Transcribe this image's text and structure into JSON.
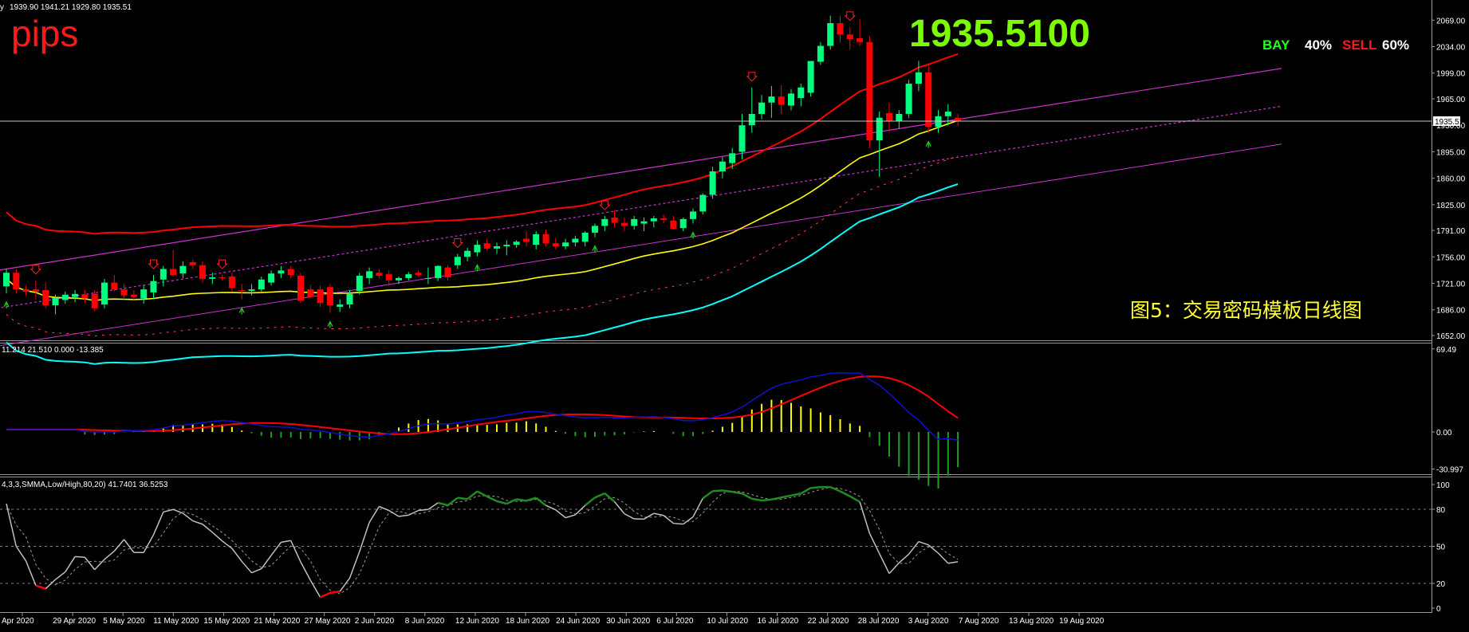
{
  "ohlc_header": "1939.90 1941.21 1929.80 1935.51",
  "watermark": "pips",
  "current_price_big": "1935.5100",
  "sentiment": {
    "buy_label": "BAY",
    "buy_pct": "40%",
    "sell_label": "SELL",
    "sell_pct": "60%",
    "buy_color": "#22ff22",
    "sell_color": "#ff1a1a"
  },
  "caption": "图5：交易密码模板日线图",
  "price_tag": "1935.51",
  "macd_label": "11.214 21.510 0.000 -13.385",
  "stoch_label": "4,3,3,SMMA,Low/High,80,20) 41.7401 36.5253",
  "colors": {
    "bull": "#00ff7f",
    "bear": "#ff0000",
    "ma_red": "#ff0000",
    "ma_yellow": "#ffff00",
    "ma_cyan": "#00ffff",
    "channel": "#cc33cc",
    "macd_signal": "#ff0000",
    "macd_main": "#0000cc",
    "stoch_main": "#c0c0c0",
    "stoch_up": "#228b22",
    "stoch_down": "#ff0000"
  },
  "chart_data": [
    {
      "type": "candlestick",
      "name": "price",
      "y_ticks": [
        "2069.00",
        "2034.00",
        "1999.00",
        "1965.00",
        "1930.00",
        "1895.00",
        "1860.00",
        "1825.00",
        "1791.00",
        "1756.00",
        "1721.00",
        "1686.00",
        "1652.00"
      ],
      "ylim": [
        1652,
        2083
      ],
      "x_labels": [
        "Apr 2020",
        "29 Apr 2020",
        "5 May 2020",
        "11 May 2020",
        "15 May 2020",
        "21 May 2020",
        "27 May 2020",
        "2 Jun 2020",
        "8 Jun 2020",
        "12 Jun 2020",
        "18 Jun 2020",
        "24 Jun 2020",
        "30 Jun 2020",
        "6 Jul 2020",
        "10 Jul 2020",
        "16 Jul 2020",
        "22 Jul 2020",
        "28 Jul 2020",
        "3 Aug 2020",
        "7 Aug 2020",
        "13 Aug 2020",
        "19 Aug 2020"
      ],
      "candles": [
        {
          "o": 1717,
          "h": 1740,
          "l": 1708,
          "c": 1735
        },
        {
          "o": 1735,
          "h": 1740,
          "l": 1708,
          "c": 1713
        },
        {
          "o": 1713,
          "h": 1718,
          "l": 1705,
          "c": 1710
        },
        {
          "o": 1713,
          "h": 1725,
          "l": 1700,
          "c": 1710
        },
        {
          "o": 1712,
          "h": 1722,
          "l": 1688,
          "c": 1692
        },
        {
          "o": 1692,
          "h": 1706,
          "l": 1680,
          "c": 1702
        },
        {
          "o": 1699,
          "h": 1710,
          "l": 1694,
          "c": 1706
        },
        {
          "o": 1703,
          "h": 1712,
          "l": 1696,
          "c": 1707
        },
        {
          "o": 1706,
          "h": 1712,
          "l": 1695,
          "c": 1701
        },
        {
          "o": 1707,
          "h": 1712,
          "l": 1684,
          "c": 1688
        },
        {
          "o": 1693,
          "h": 1727,
          "l": 1688,
          "c": 1722
        },
        {
          "o": 1722,
          "h": 1732,
          "l": 1710,
          "c": 1713
        },
        {
          "o": 1713,
          "h": 1720,
          "l": 1700,
          "c": 1705
        },
        {
          "o": 1706,
          "h": 1712,
          "l": 1698,
          "c": 1703
        },
        {
          "o": 1701,
          "h": 1718,
          "l": 1694,
          "c": 1713
        },
        {
          "o": 1709,
          "h": 1732,
          "l": 1700,
          "c": 1724
        },
        {
          "o": 1726,
          "h": 1744,
          "l": 1717,
          "c": 1740
        },
        {
          "o": 1740,
          "h": 1765,
          "l": 1730,
          "c": 1732
        },
        {
          "o": 1734,
          "h": 1750,
          "l": 1728,
          "c": 1744
        },
        {
          "o": 1749,
          "h": 1752,
          "l": 1740,
          "c": 1745
        },
        {
          "o": 1745,
          "h": 1750,
          "l": 1722,
          "c": 1727
        },
        {
          "o": 1727,
          "h": 1735,
          "l": 1720,
          "c": 1729
        },
        {
          "o": 1729,
          "h": 1732,
          "l": 1725,
          "c": 1728
        },
        {
          "o": 1730,
          "h": 1735,
          "l": 1710,
          "c": 1715
        },
        {
          "o": 1712,
          "h": 1720,
          "l": 1700,
          "c": 1711
        },
        {
          "o": 1711,
          "h": 1720,
          "l": 1705,
          "c": 1713
        },
        {
          "o": 1713,
          "h": 1730,
          "l": 1710,
          "c": 1726
        },
        {
          "o": 1722,
          "h": 1738,
          "l": 1718,
          "c": 1734
        },
        {
          "o": 1734,
          "h": 1744,
          "l": 1728,
          "c": 1738
        },
        {
          "o": 1740,
          "h": 1744,
          "l": 1728,
          "c": 1732
        },
        {
          "o": 1731,
          "h": 1735,
          "l": 1695,
          "c": 1698
        },
        {
          "o": 1713,
          "h": 1718,
          "l": 1702,
          "c": 1703
        },
        {
          "o": 1713,
          "h": 1718,
          "l": 1690,
          "c": 1695
        },
        {
          "o": 1716,
          "h": 1720,
          "l": 1682,
          "c": 1692
        },
        {
          "o": 1690,
          "h": 1700,
          "l": 1683,
          "c": 1693
        },
        {
          "o": 1693,
          "h": 1712,
          "l": 1688,
          "c": 1707
        },
        {
          "o": 1711,
          "h": 1735,
          "l": 1706,
          "c": 1731
        },
        {
          "o": 1728,
          "h": 1742,
          "l": 1720,
          "c": 1737
        },
        {
          "o": 1735,
          "h": 1740,
          "l": 1728,
          "c": 1731
        },
        {
          "o": 1733,
          "h": 1738,
          "l": 1718,
          "c": 1725
        },
        {
          "o": 1725,
          "h": 1730,
          "l": 1720,
          "c": 1728
        },
        {
          "o": 1728,
          "h": 1736,
          "l": 1725,
          "c": 1733
        },
        {
          "o": 1735,
          "h": 1738,
          "l": 1730,
          "c": 1732
        },
        {
          "o": 1727,
          "h": 1742,
          "l": 1720,
          "c": 1728
        },
        {
          "o": 1728,
          "h": 1745,
          "l": 1724,
          "c": 1744
        },
        {
          "o": 1742,
          "h": 1745,
          "l": 1725,
          "c": 1729
        },
        {
          "o": 1745,
          "h": 1760,
          "l": 1740,
          "c": 1756
        },
        {
          "o": 1756,
          "h": 1768,
          "l": 1750,
          "c": 1764
        },
        {
          "o": 1762,
          "h": 1778,
          "l": 1757,
          "c": 1772
        },
        {
          "o": 1774,
          "h": 1780,
          "l": 1765,
          "c": 1767
        },
        {
          "o": 1767,
          "h": 1775,
          "l": 1760,
          "c": 1770
        },
        {
          "o": 1770,
          "h": 1778,
          "l": 1758,
          "c": 1772
        },
        {
          "o": 1772,
          "h": 1778,
          "l": 1768,
          "c": 1776
        },
        {
          "o": 1780,
          "h": 1790,
          "l": 1770,
          "c": 1776
        },
        {
          "o": 1772,
          "h": 1790,
          "l": 1766,
          "c": 1786
        },
        {
          "o": 1786,
          "h": 1792,
          "l": 1770,
          "c": 1774
        },
        {
          "o": 1774,
          "h": 1781,
          "l": 1766,
          "c": 1770
        },
        {
          "o": 1770,
          "h": 1780,
          "l": 1766,
          "c": 1775
        },
        {
          "o": 1775,
          "h": 1784,
          "l": 1770,
          "c": 1780
        },
        {
          "o": 1776,
          "h": 1790,
          "l": 1770,
          "c": 1788
        },
        {
          "o": 1788,
          "h": 1800,
          "l": 1782,
          "c": 1797
        },
        {
          "o": 1797,
          "h": 1810,
          "l": 1790,
          "c": 1806
        },
        {
          "o": 1808,
          "h": 1818,
          "l": 1795,
          "c": 1801
        },
        {
          "o": 1801,
          "h": 1808,
          "l": 1790,
          "c": 1797
        },
        {
          "o": 1797,
          "h": 1810,
          "l": 1792,
          "c": 1806
        },
        {
          "o": 1800,
          "h": 1808,
          "l": 1790,
          "c": 1803
        },
        {
          "o": 1803,
          "h": 1810,
          "l": 1795,
          "c": 1807
        },
        {
          "o": 1807,
          "h": 1812,
          "l": 1800,
          "c": 1805
        },
        {
          "o": 1804,
          "h": 1810,
          "l": 1792,
          "c": 1793
        },
        {
          "o": 1794,
          "h": 1808,
          "l": 1790,
          "c": 1806
        },
        {
          "o": 1806,
          "h": 1820,
          "l": 1800,
          "c": 1816
        },
        {
          "o": 1816,
          "h": 1840,
          "l": 1812,
          "c": 1838
        },
        {
          "o": 1838,
          "h": 1875,
          "l": 1833,
          "c": 1869
        },
        {
          "o": 1869,
          "h": 1888,
          "l": 1860,
          "c": 1882
        },
        {
          "o": 1880,
          "h": 1900,
          "l": 1872,
          "c": 1893
        },
        {
          "o": 1895,
          "h": 1945,
          "l": 1885,
          "c": 1930
        },
        {
          "o": 1930,
          "h": 1980,
          "l": 1920,
          "c": 1945
        },
        {
          "o": 1945,
          "h": 1970,
          "l": 1938,
          "c": 1960
        },
        {
          "o": 1960,
          "h": 1982,
          "l": 1940,
          "c": 1968
        },
        {
          "o": 1968,
          "h": 1983,
          "l": 1945,
          "c": 1957
        },
        {
          "o": 1956,
          "h": 1978,
          "l": 1950,
          "c": 1972
        },
        {
          "o": 1966,
          "h": 1985,
          "l": 1955,
          "c": 1980
        },
        {
          "o": 1973,
          "h": 2015,
          "l": 1968,
          "c": 2015
        },
        {
          "o": 2014,
          "h": 2040,
          "l": 2010,
          "c": 2035
        },
        {
          "o": 2035,
          "h": 2075,
          "l": 2030,
          "c": 2065
        },
        {
          "o": 2065,
          "h": 2075,
          "l": 2040,
          "c": 2050
        },
        {
          "o": 2050,
          "h": 2060,
          "l": 2030,
          "c": 2044
        },
        {
          "o": 2045,
          "h": 2070,
          "l": 2035,
          "c": 2040
        },
        {
          "o": 2040,
          "h": 2048,
          "l": 1900,
          "c": 1910
        },
        {
          "o": 1910,
          "h": 1948,
          "l": 1862,
          "c": 1940
        },
        {
          "o": 1946,
          "h": 1960,
          "l": 1922,
          "c": 1935
        },
        {
          "o": 1935,
          "h": 1950,
          "l": 1925,
          "c": 1945
        },
        {
          "o": 1945,
          "h": 1990,
          "l": 1940,
          "c": 1985
        },
        {
          "o": 1985,
          "h": 2015,
          "l": 1975,
          "c": 2000
        },
        {
          "o": 2000,
          "h": 2012,
          "l": 1920,
          "c": 1928
        },
        {
          "o": 1928,
          "h": 1950,
          "l": 1920,
          "c": 1942
        },
        {
          "o": 1942,
          "h": 1958,
          "l": 1930,
          "c": 1948
        },
        {
          "o": 1940,
          "h": 1945,
          "l": 1929,
          "c": 1935.51
        }
      ],
      "up_arrows": [
        0,
        24,
        33,
        48,
        60,
        70,
        94
      ],
      "down_arrows": [
        3,
        15,
        22,
        46,
        61,
        76,
        86
      ]
    },
    {
      "type": "line",
      "name": "macd",
      "y_ticks": [
        "69.49",
        "0.00",
        "-30.997"
      ],
      "ylim": [
        -34,
        72
      ]
    },
    {
      "type": "line",
      "name": "stochastic",
      "y_ticks": [
        "100",
        "80",
        "50",
        "20",
        "0"
      ],
      "ylim": [
        0,
        100
      ]
    }
  ]
}
